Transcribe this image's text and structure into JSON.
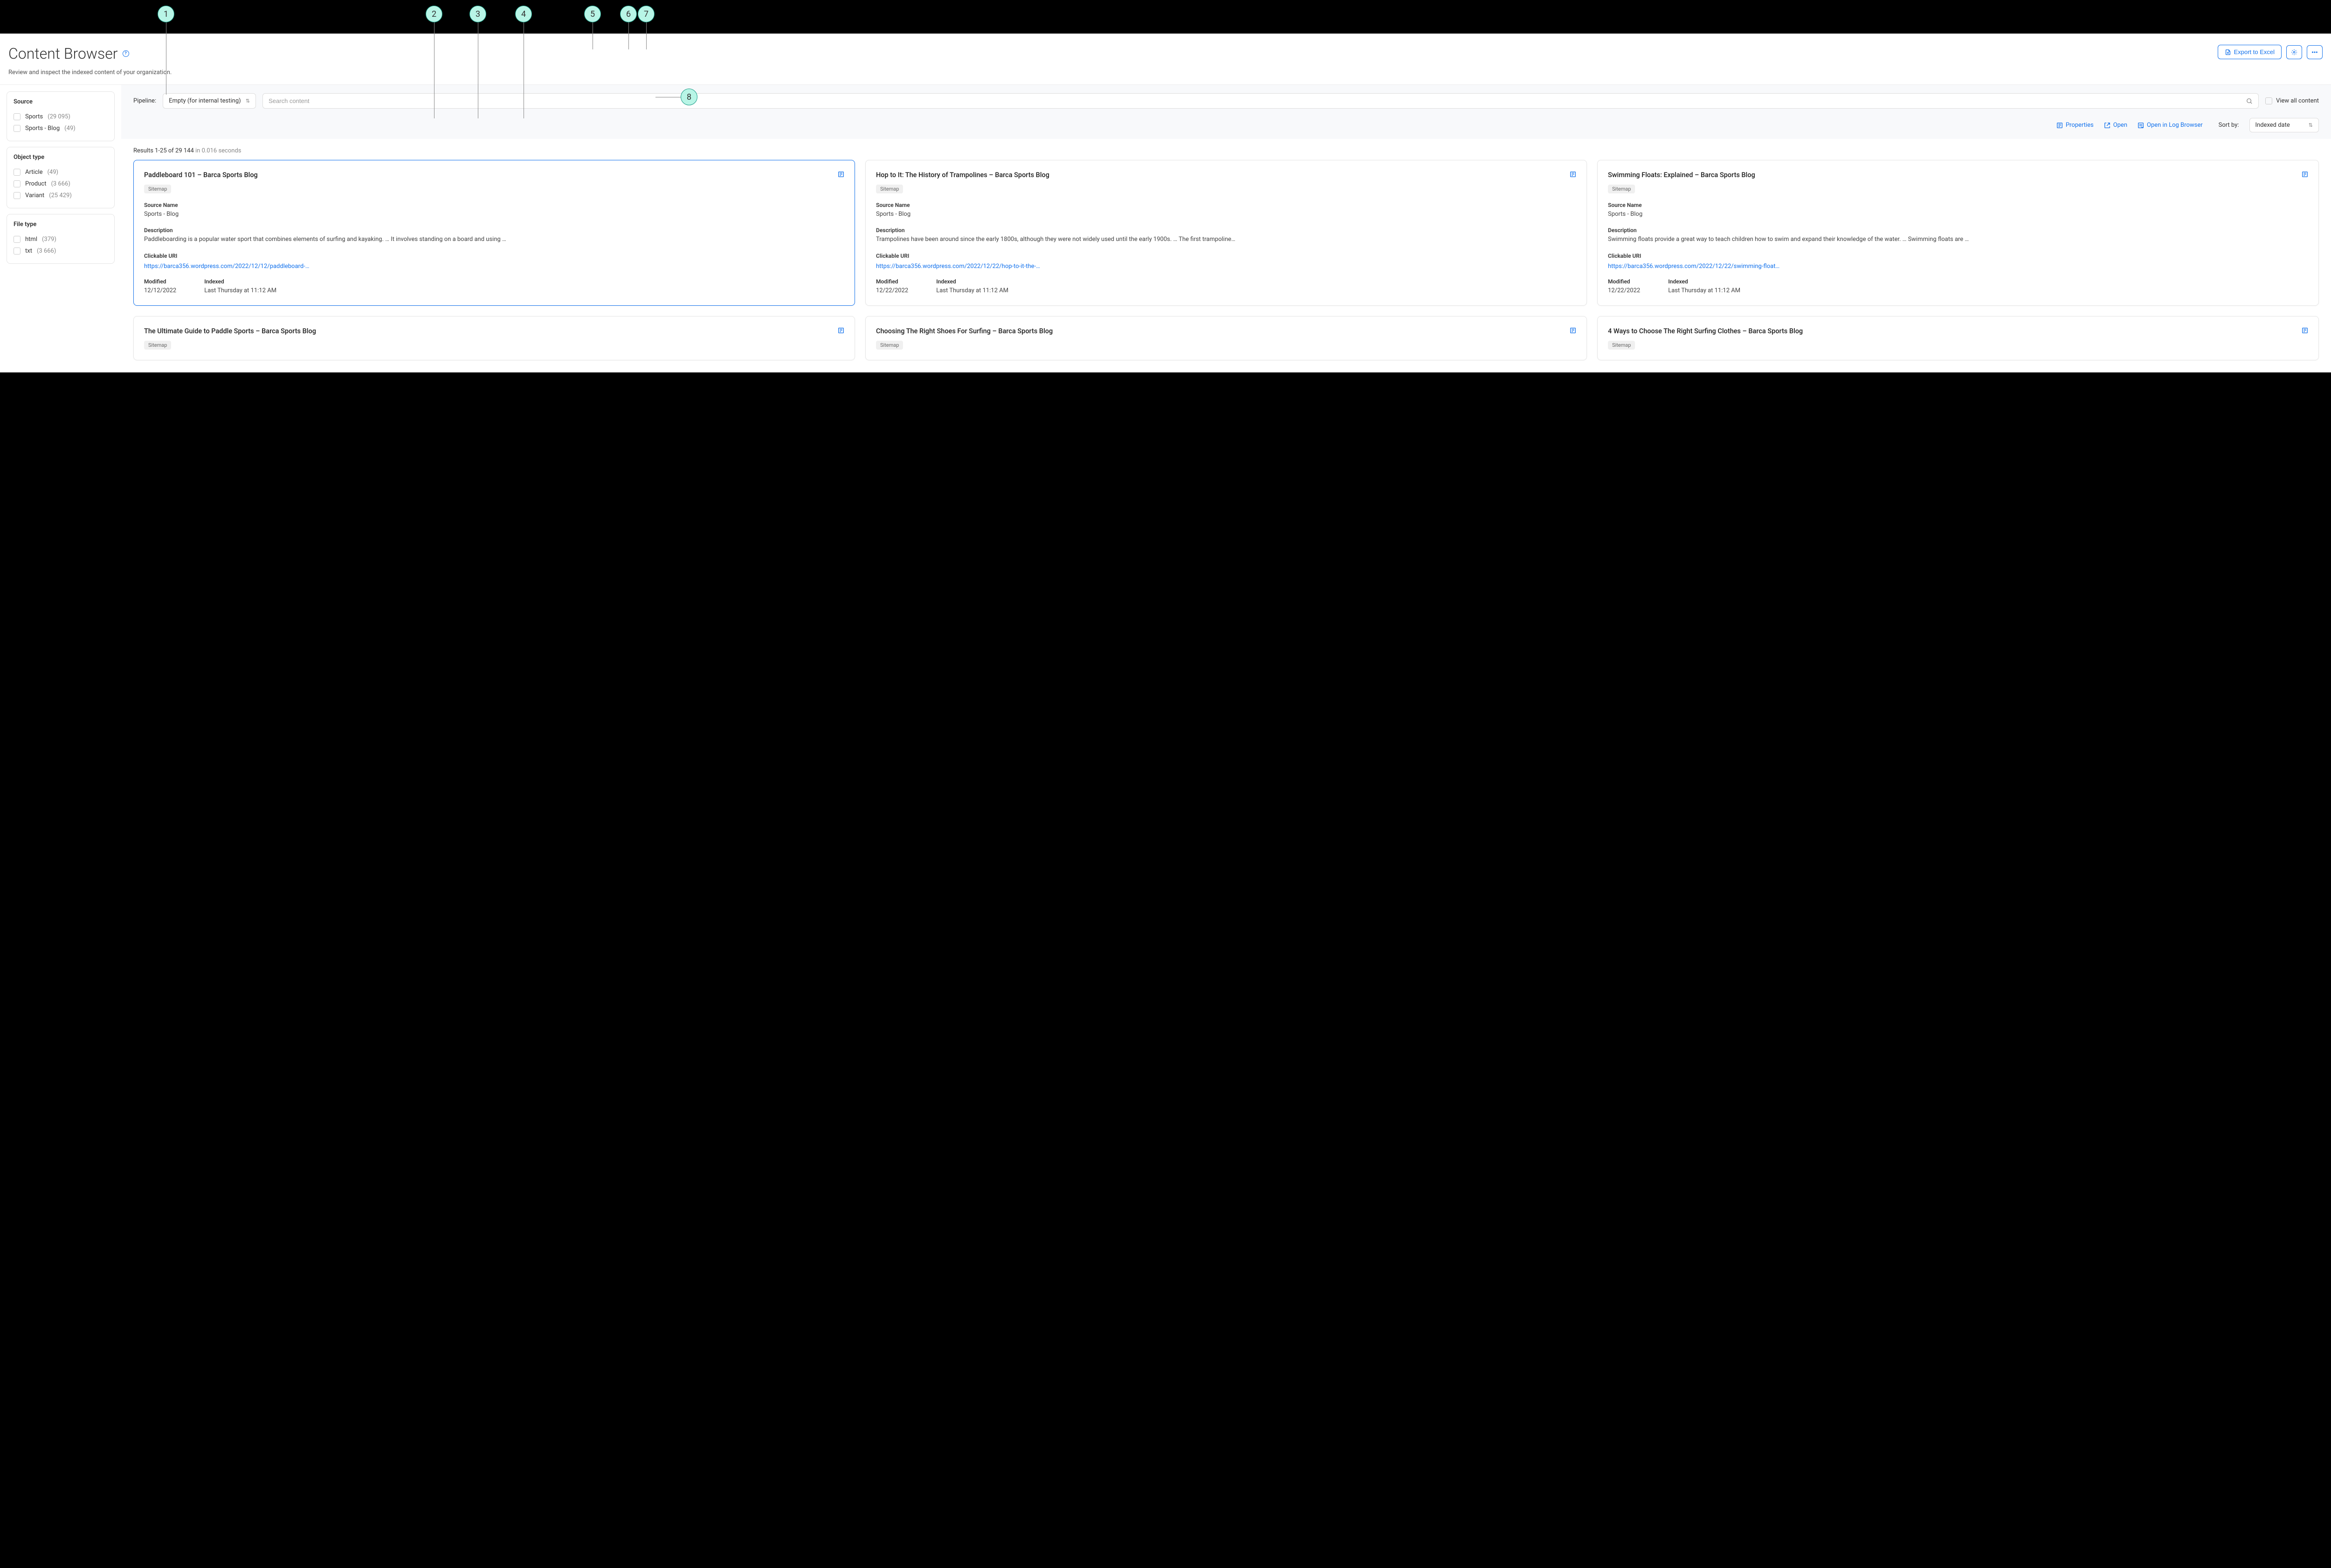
{
  "header": {
    "title": "Content Browser",
    "subtitle": "Review and inspect the indexed content of your organization.",
    "export_label": "Export to Excel"
  },
  "callouts": [
    "1",
    "2",
    "3",
    "4",
    "5",
    "6",
    "7",
    "8"
  ],
  "facets": [
    {
      "title": "Source",
      "items": [
        {
          "label": "Sports",
          "count": "(29 095)"
        },
        {
          "label": "Sports - Blog",
          "count": "(49)"
        }
      ]
    },
    {
      "title": "Object type",
      "items": [
        {
          "label": "Article",
          "count": "(49)"
        },
        {
          "label": "Product",
          "count": "(3 666)"
        },
        {
          "label": "Variant",
          "count": "(25 429)"
        }
      ]
    },
    {
      "title": "File type",
      "items": [
        {
          "label": "html",
          "count": "(379)"
        },
        {
          "label": "txt",
          "count": "(3 666)"
        }
      ]
    }
  ],
  "toolbar": {
    "pipeline_label": "Pipeline:",
    "pipeline_value": "Empty (for internal testing)",
    "search_placeholder": "Search content",
    "view_all_label": "View all content",
    "properties_label": "Properties",
    "open_label": "Open",
    "open_log_label": "Open in Log Browser",
    "sort_label": "Sort by:",
    "sort_value": "Indexed date"
  },
  "results": {
    "summary_prefix": "Results 1-25 of 29 144",
    "summary_time": " in 0.016 seconds"
  },
  "labels": {
    "source_name": "Source Name",
    "description": "Description",
    "clickable_uri": "Clickable URI",
    "modified": "Modified",
    "indexed": "Indexed"
  },
  "cards": [
    {
      "title": "Paddleboard 101 – Barca Sports Blog",
      "badge": "Sitemap",
      "source_name": "Sports - Blog",
      "description": "Paddleboarding is a popular water sport that combines elements of surfing and kayaking. … It involves standing on a board and using …",
      "uri": "https://barca356.wordpress.com/2022/12/12/paddleboard-…",
      "modified": "12/12/2022",
      "indexed": "Last Thursday at 11:12 AM",
      "selected": true
    },
    {
      "title": "Hop to It: The History of Trampolines – Barca Sports Blog",
      "badge": "Sitemap",
      "source_name": "Sports - Blog",
      "description": "Trampolines have been around since the early 1800s, although they were not widely used until the early 1900s. … The first trampoline…",
      "uri": "https://barca356.wordpress.com/2022/12/22/hop-to-it-the-…",
      "modified": "12/22/2022",
      "indexed": "Last Thursday at 11:12 AM",
      "selected": false
    },
    {
      "title": "Swimming Floats: Explained – Barca Sports Blog",
      "badge": "Sitemap",
      "source_name": "Sports - Blog",
      "description": "Swimming floats provide a great way to teach children how to swim and expand their knowledge of the water. … Swimming floats are …",
      "uri": "https://barca356.wordpress.com/2022/12/22/swimming-float…",
      "modified": "12/22/2022",
      "indexed": "Last Thursday at 11:12 AM",
      "selected": false
    },
    {
      "title": "The Ultimate Guide to Paddle Sports – Barca Sports Blog",
      "badge": "Sitemap",
      "selected": false
    },
    {
      "title": "Choosing The Right Shoes For Surfing – Barca Sports Blog",
      "badge": "Sitemap",
      "selected": false
    },
    {
      "title": "4 Ways to Choose The Right Surfing Clothes – Barca Sports Blog",
      "badge": "Sitemap",
      "selected": false
    }
  ]
}
